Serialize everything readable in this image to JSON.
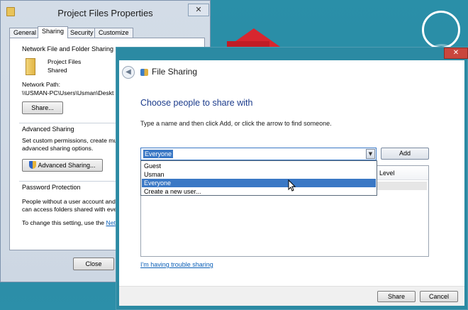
{
  "props": {
    "title": "Project Files Properties",
    "close_label": "✕",
    "tabs": [
      {
        "label": "General"
      },
      {
        "label": "Sharing"
      },
      {
        "label": "Security"
      },
      {
        "label": "Customize"
      }
    ],
    "network_group_title": "Network File and Folder Sharing",
    "folder_name": "Project Files",
    "folder_status": "Shared",
    "network_path_label": "Network Path:",
    "network_path_value": "\\\\USMAN-PC\\Users\\Usman\\Deskt",
    "share_button": "Share...",
    "advanced_group_title": "Advanced Sharing",
    "advanced_line1": "Set custom permissions, create mult",
    "advanced_line2": "advanced sharing options.",
    "advanced_button": "Advanced Sharing...",
    "password_group_title": "Password Protection",
    "password_line1": "People without a user account and",
    "password_line2": "can access folders shared with eve",
    "password_line3": "To change this setting, use the",
    "password_link": "Net",
    "close_button": "Close"
  },
  "file_sharing": {
    "title": "File Sharing",
    "close_label": "✕",
    "back_label": "◀",
    "heading": "Choose people to share with",
    "instruction": "Type a name and then click Add, or click the arrow to find someone.",
    "input_value": "Everyone",
    "add_button": "Add",
    "list_header_level": "Level",
    "dropdown_options": [
      "Guest",
      "Usman",
      "Everyone",
      "Create a new user..."
    ],
    "selected_option": "Everyone",
    "trouble_link": "I'm having trouble sharing",
    "share_button": "Share",
    "cancel_button": "Cancel"
  },
  "colors": {
    "selection_blue": "#3a78c5",
    "heading_blue": "#1c3c8c",
    "desktop_teal": "#2b8aa3"
  }
}
